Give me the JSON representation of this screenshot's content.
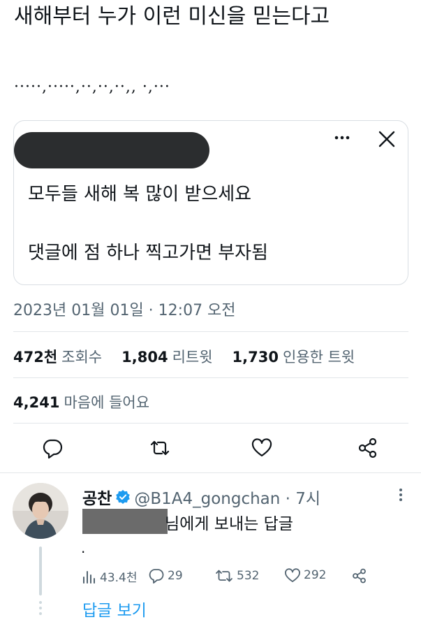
{
  "tweet": {
    "text": "새해부터 누가 이런 미신을 믿는다고",
    "dots": "·····,·····,··,··,··,, ·,···"
  },
  "quote": {
    "line1": "모두들 새해 복 많이 받으세요",
    "line2": "댓글에 점 하나 찍고가면 부자됨"
  },
  "timestamp": "2023년 01월 01일 · 12:07 오전",
  "stats": {
    "views_num": "472천",
    "views_label": "조회수",
    "retweets_num": "1,804",
    "retweets_label": "리트윗",
    "quotes_num": "1,730",
    "quotes_label": "인용한 트윗",
    "likes_num": "4,241",
    "likes_label": "마음에 들어요"
  },
  "actions": [
    "reply-icon",
    "retweet-icon",
    "like-icon",
    "share-icon"
  ],
  "reply": {
    "name": "공찬",
    "handle": "@B1A4_gongchan · 7시",
    "text": "님에게 보내는 답글",
    "body": ".",
    "views": "43.4천",
    "replies": "29",
    "retweets": "532",
    "likes": "292",
    "show_replies": "답글 보기"
  },
  "colors": {
    "text": "#0f1419",
    "secondary": "#536471",
    "accent": "#1d9bf0",
    "border": "#e3e6e9"
  }
}
